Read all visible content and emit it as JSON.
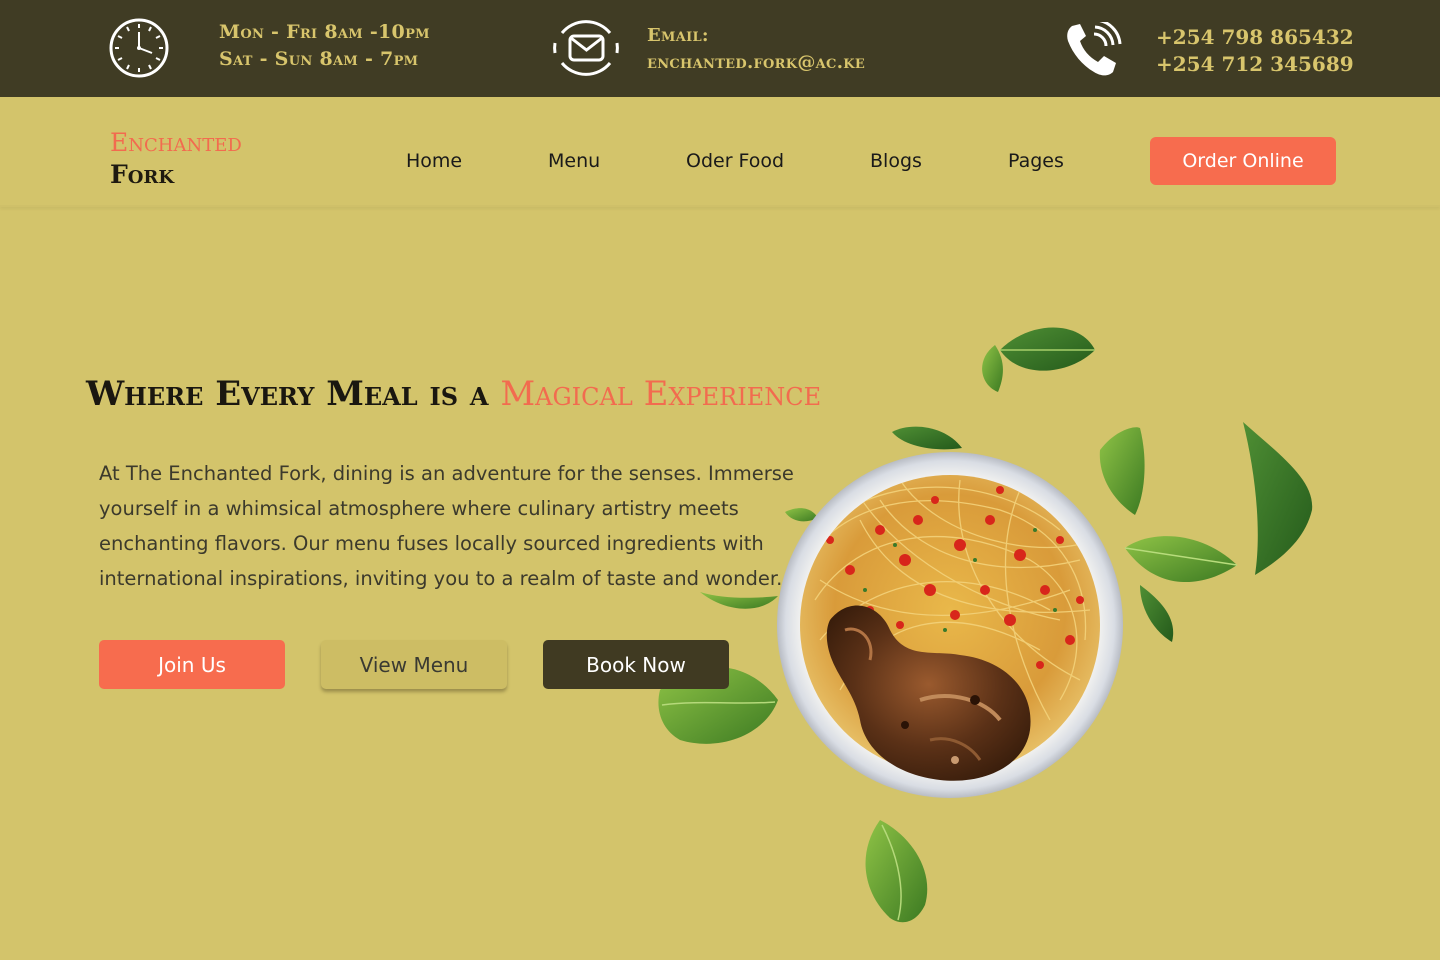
{
  "topbar": {
    "hours_line1": "Mon - Fri 8am -10pm",
    "hours_line2": "Sat - Sun 8am - 7pm",
    "email_label": "Email:",
    "email_value": "enchanted.fork@ac.ke",
    "phone_1": "+254 798 865432",
    "phone_2": "+254 712 345689",
    "icons": [
      "clock-icon",
      "mail-icon",
      "phone-icon"
    ]
  },
  "nav": {
    "logo_line1": "Enchanted",
    "logo_line2": "Fork",
    "items": [
      "Home",
      "Menu",
      "Oder Food",
      "Blogs",
      "Pages"
    ],
    "cta": "Order Online"
  },
  "hero": {
    "headline_part1": "Where Every Meal is a",
    "headline_part2": "Magical Experience",
    "description": "At The Enchanted Fork, dining is an adventure for the senses. Immerse yourself in a whimsical atmosphere where culinary artistry meets enchanting flavors. Our menu fuses locally sourced ingredients with international inspirations, inviting you to a realm of taste and wonder.",
    "buttons": {
      "join": "Join Us",
      "menu": "View Menu",
      "book": "Book Now"
    }
  },
  "colors": {
    "background": "#d3c46b",
    "topbar": "#403c24",
    "accent": "#f76c4e",
    "topbar_text": "#d8c56c",
    "dark_button": "#403a22"
  }
}
